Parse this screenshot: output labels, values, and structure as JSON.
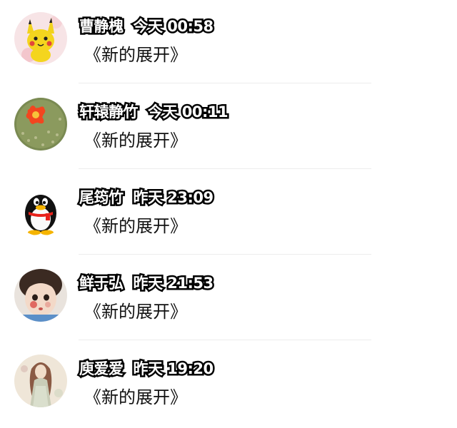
{
  "comments": [
    {
      "author": "曹静槐",
      "time": "今天 00:58",
      "text": "《新的展开》",
      "avatar": "pikachu-avatar"
    },
    {
      "author": "轩辕静竹",
      "time": "今天 00:11",
      "text": "《新的展开》",
      "avatar": "cactus-flower-avatar"
    },
    {
      "author": "尾筠竹",
      "time": "昨天 23:09",
      "text": "《新的展开》",
      "avatar": "qq-penguin-avatar"
    },
    {
      "author": "鲜于弘",
      "time": "昨天 21:53",
      "text": "《新的展开》",
      "avatar": "child-photo-avatar"
    },
    {
      "author": "庾爱爱",
      "time": "昨天 19:20",
      "text": "《新的展开》",
      "avatar": "painted-girl-avatar"
    }
  ]
}
